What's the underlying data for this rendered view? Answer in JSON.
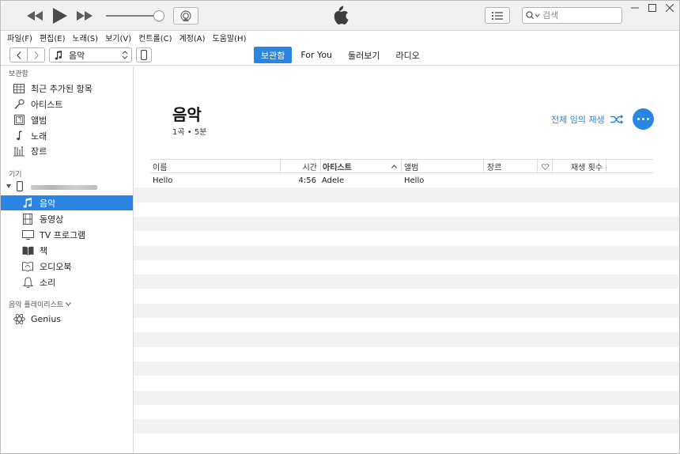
{
  "menu": [
    "파일(F)",
    "편집(E)",
    "노래(S)",
    "보기(V)",
    "컨트롤(C)",
    "계정(A)",
    "도움말(H)"
  ],
  "search": {
    "placeholder": "검색"
  },
  "nav": {
    "media_selector": "음악"
  },
  "tabs": [
    {
      "label": "보관함",
      "active": true
    },
    {
      "label": "For You",
      "active": false
    },
    {
      "label": "둘러보기",
      "active": false
    },
    {
      "label": "라디오",
      "active": false
    }
  ],
  "sidebar": {
    "library_title": "보관함",
    "library_items": [
      {
        "label": "최근 추가된 항목",
        "icon": "grid-icon"
      },
      {
        "label": "아티스트",
        "icon": "microphone-icon"
      },
      {
        "label": "앨범",
        "icon": "album-icon"
      },
      {
        "label": "노래",
        "icon": "music-note-icon"
      },
      {
        "label": "장르",
        "icon": "genre-icon"
      }
    ],
    "devices_title": "기기",
    "device_items": [
      {
        "label": "음악",
        "icon": "music-note-icon",
        "selected": true
      },
      {
        "label": "동영상",
        "icon": "film-icon",
        "selected": false
      },
      {
        "label": "TV 프로그램",
        "icon": "tv-icon",
        "selected": false
      },
      {
        "label": "책",
        "icon": "book-icon",
        "selected": false
      },
      {
        "label": "오디오북",
        "icon": "audiobook-icon",
        "selected": false
      },
      {
        "label": "소리",
        "icon": "bell-icon",
        "selected": false
      }
    ],
    "playlists_title": "음악 플레이리스트",
    "playlist_items": [
      {
        "label": "Genius",
        "icon": "genius-icon"
      }
    ]
  },
  "main": {
    "title": "음악",
    "subtitle": "1곡 • 5분",
    "shuffle_label": "전체 임의 재생",
    "columns": {
      "name": "이름",
      "time": "시간",
      "artist": "아티스트",
      "album": "앨범",
      "genre": "장르",
      "plays": "재생 횟수"
    },
    "rows": [
      {
        "name": "Hello",
        "time": "4:56",
        "artist": "Adele",
        "album": "Hello"
      }
    ]
  },
  "colors": {
    "accent": "#2b86e3",
    "row_alt": "#f2f2f2"
  }
}
